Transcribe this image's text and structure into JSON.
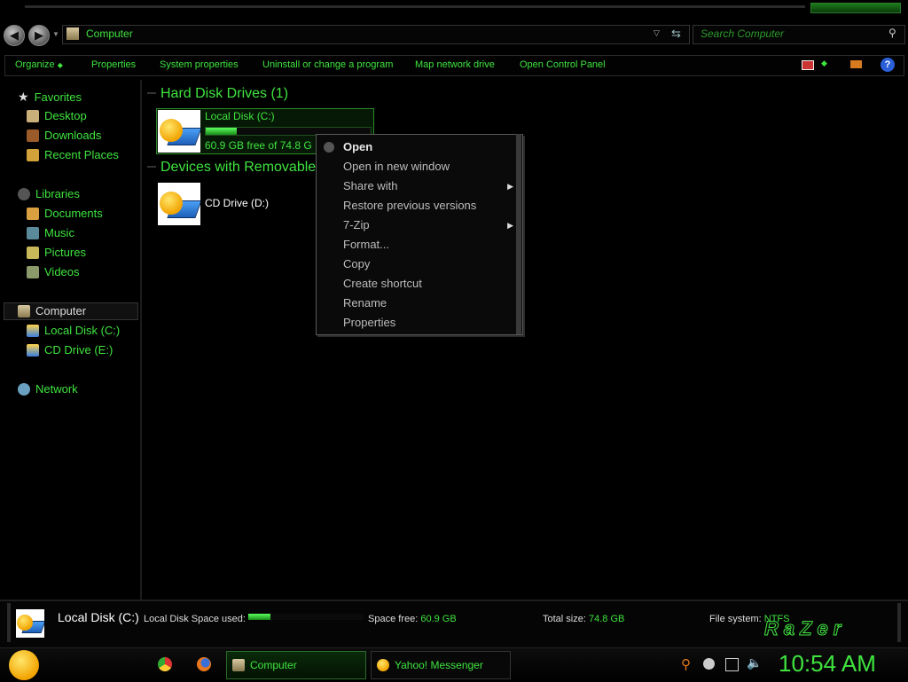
{
  "window": {
    "address": "Computer",
    "search_placeholder": "Search Computer"
  },
  "toolbar": {
    "organize": "Organize",
    "properties": "Properties",
    "system_properties": "System properties",
    "uninstall": "Uninstall or change a program",
    "map_drive": "Map network drive",
    "control_panel": "Open Control Panel"
  },
  "nav": {
    "favorites": "Favorites",
    "desktop": "Desktop",
    "downloads": "Downloads",
    "recent": "Recent Places",
    "libraries": "Libraries",
    "documents": "Documents",
    "music": "Music",
    "pictures": "Pictures",
    "videos": "Videos",
    "computer": "Computer",
    "local_disk": "Local Disk (C:)",
    "cd_drive": "CD Drive (E:)",
    "network": "Network"
  },
  "content": {
    "group_hdd": "Hard Disk Drives (1)",
    "group_removable": "Devices with Removable",
    "drive_c_name": "Local Disk (C:)",
    "drive_c_free": "60.9 GB free of 74.8 G",
    "drive_c_used_fraction": 0.19,
    "drive_d_name": "CD Drive (D:)"
  },
  "context_menu": {
    "open": "Open",
    "open_new": "Open in new window",
    "share": "Share with",
    "restore": "Restore previous versions",
    "zip": "7-Zip",
    "format": "Format...",
    "copy": "Copy",
    "shortcut": "Create shortcut",
    "rename": "Rename",
    "properties": "Properties"
  },
  "details": {
    "name": "Local Disk (C:)",
    "space_used_label": "Local Disk Space used:",
    "space_free_label": "Space free:",
    "space_free_value": "60.9 GB",
    "total_label": "Total size:",
    "total_value": "74.8 GB",
    "fs_label": "File system:",
    "fs_value": "NTFS",
    "brand": "RaZer"
  },
  "taskbar": {
    "computer": "Computer",
    "messenger": "Yahoo! Messenger",
    "clock": "10:54 AM"
  },
  "colors": {
    "accent": "#3fe43f",
    "background": "#000000",
    "menu_text": "#bcbcbc"
  }
}
